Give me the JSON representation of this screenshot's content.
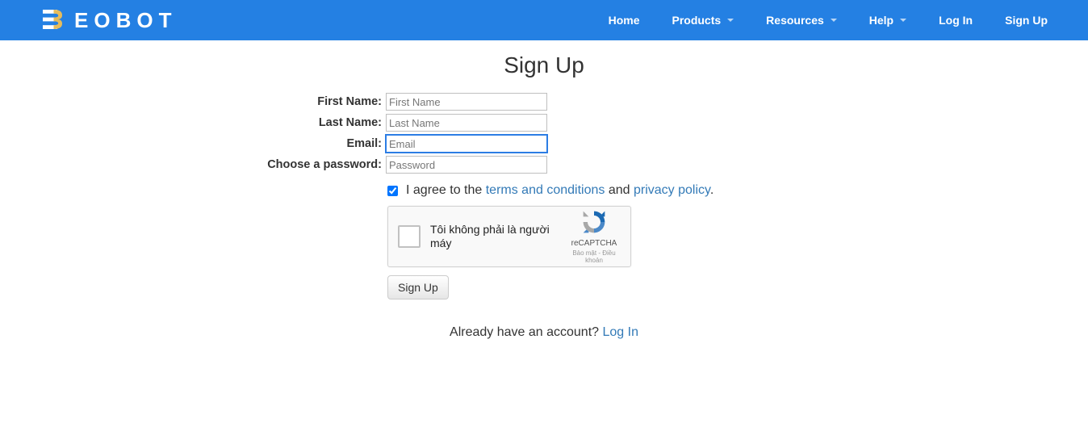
{
  "brand": {
    "name": "EOBOT"
  },
  "nav": {
    "home": "Home",
    "products": "Products",
    "resources": "Resources",
    "help": "Help",
    "login": "Log In",
    "signup": "Sign Up"
  },
  "page": {
    "title": "Sign Up"
  },
  "form": {
    "first_name": {
      "label": "First Name:",
      "placeholder": "First Name",
      "value": ""
    },
    "last_name": {
      "label": "Last Name:",
      "placeholder": "Last Name",
      "value": ""
    },
    "email": {
      "label": "Email:",
      "placeholder": "Email",
      "value": ""
    },
    "password": {
      "label": "Choose a password:",
      "placeholder": "Password",
      "value": ""
    },
    "agree": {
      "checked": true,
      "prefix": "I agree to the ",
      "terms_link": "terms and conditions",
      "and": " and ",
      "privacy_link": "privacy policy",
      "suffix": "."
    },
    "recaptcha": {
      "label": "Tôi không phải là người máy",
      "brand": "reCAPTCHA",
      "terms": "Bảo mật - Điều khoản"
    },
    "submit": "Sign Up"
  },
  "login_prompt": {
    "text": "Already have an account? ",
    "link": "Log In"
  }
}
